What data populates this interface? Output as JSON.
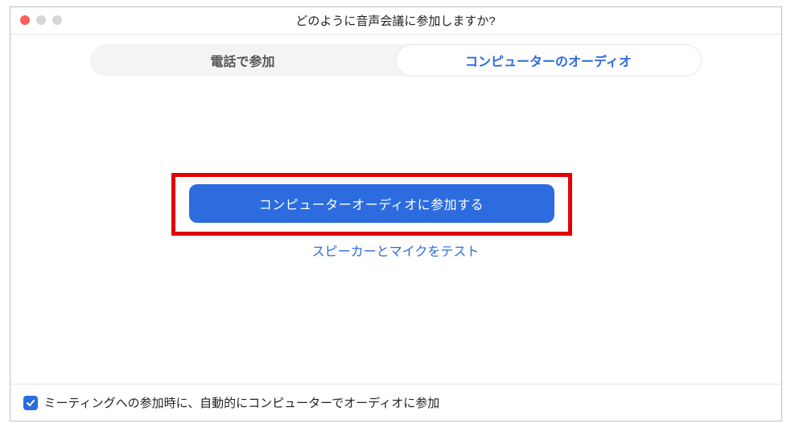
{
  "window": {
    "title": "どのように音声会議に参加しますか?"
  },
  "tabs": {
    "phone": "電話で参加",
    "computer": "コンピューターのオーディオ"
  },
  "main": {
    "join_button": "コンピューターオーディオに参加する",
    "test_link": "スピーカーとマイクをテスト"
  },
  "footer": {
    "auto_join_label": "ミーティングへの参加時に、自動的にコンピューターでオーディオに参加",
    "auto_join_checked": true
  },
  "colors": {
    "accent": "#2d6cdf",
    "highlight": "#e20000"
  }
}
